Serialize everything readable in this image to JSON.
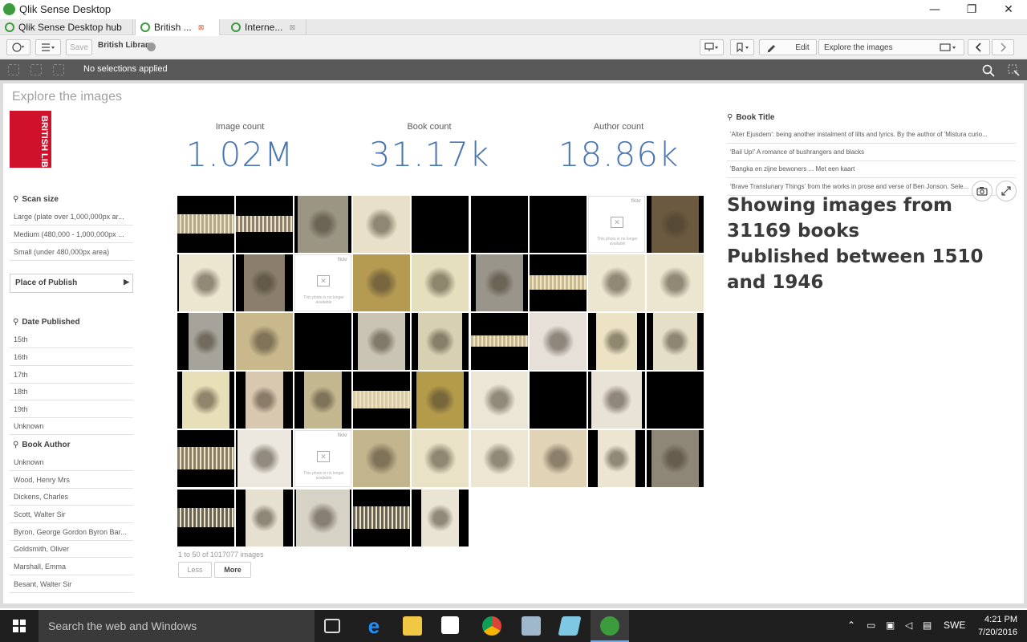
{
  "window": {
    "title": "Qlik Sense Desktop",
    "minimize": "—",
    "maximize": "❐",
    "close": "✕"
  },
  "tabs": [
    {
      "label": "Qlik Sense Desktop hub"
    },
    {
      "label": "British ...",
      "close": "⊠"
    },
    {
      "label": "Interne...",
      "close": "⊠"
    }
  ],
  "toolbar": {
    "save_label": "Save",
    "app_name": "British Library",
    "edit_label": "Edit",
    "sheet_name": "Explore the images"
  },
  "selections": {
    "text": "No selections applied"
  },
  "sheet": {
    "title": "Explore the images"
  },
  "logo": {
    "text": "BRITISH LIBRARY"
  },
  "filters": {
    "scan_size": {
      "title": "Scan size",
      "items": [
        "Large (plate over 1,000,000px ar...",
        "Medium (480,000 - 1,000,000px ...",
        "Small (under 480,000px area)"
      ]
    },
    "place": {
      "title": "Place of Publish"
    },
    "date_published": {
      "title": "Date Published",
      "items": [
        "15th",
        "16th",
        "17th",
        "18th",
        "19th",
        "Unknown"
      ]
    },
    "author": {
      "title": "Book Author",
      "items": [
        "Unknown",
        "Wood, Henry Mrs",
        "Dickens, Charles",
        "Scott, Walter Sir",
        "Byron, George Gordon Byron Bar...",
        "Goldsmith, Oliver",
        "Marshall, Emma",
        "Besant, Walter Sir"
      ]
    }
  },
  "kpis": [
    {
      "label": "Image count",
      "value": "1.02M"
    },
    {
      "label": "Book count",
      "value": "31.17k"
    },
    {
      "label": "Author count",
      "value": "18.86k"
    }
  ],
  "images": {
    "flickr_text": "flickr",
    "flickr_msg": "This photo is no longer available",
    "pager": "1 to 50 of 1017077 images",
    "less_label": "Less",
    "more_label": "More"
  },
  "book_title": {
    "title": "Book Title",
    "items": [
      "'Alter Ejusdem': being another instalment of lilts and lyrics. By the author of 'Mistura curio...",
      "'Bail Up!' A romance of bushrangers and blacks",
      "'Bangka en zijne bewoners ... Met een kaart",
      "'Brave Translunary Things' from the works in prose and verse of Ben Jonson. Sele..."
    ]
  },
  "summary": {
    "line1": "Showing images from 31169 books",
    "line2": "Published between 1510 and 1946"
  },
  "taskbar": {
    "search": "Search the web and Windows",
    "lang": "SWE",
    "time": "4:21 PM",
    "date": "7/20/2016"
  }
}
